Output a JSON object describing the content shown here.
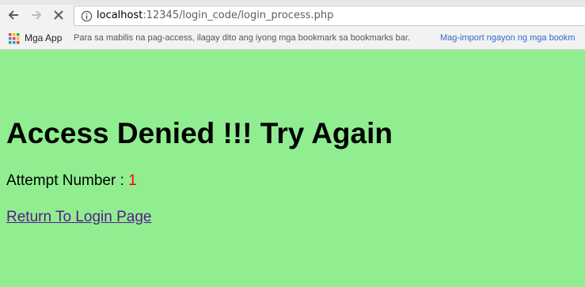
{
  "browser": {
    "url_host": "localhost",
    "url_rest": ":12345/login_code/login_process.php",
    "back_icon": "arrow-left-icon",
    "forward_icon": "arrow-right-icon",
    "stop_icon": "close-icon",
    "info_icon": "info-icon"
  },
  "bookmarks": {
    "apps_label": "Mga App",
    "hint": "Para sa mabilis na pag-access, ilagay dito ang iyong mga bookmark sa bookmarks bar.",
    "import_link": "Mag-import ngayon ng mga bookm"
  },
  "page": {
    "background": "#90ee90",
    "heading": "Access Denied !!! Try Again",
    "attempt_label": "Attempt Number : ",
    "attempt_number": "1",
    "attempt_number_color": "#ff0000",
    "return_link": "Return To Login Page",
    "link_color": "#551a8b"
  }
}
